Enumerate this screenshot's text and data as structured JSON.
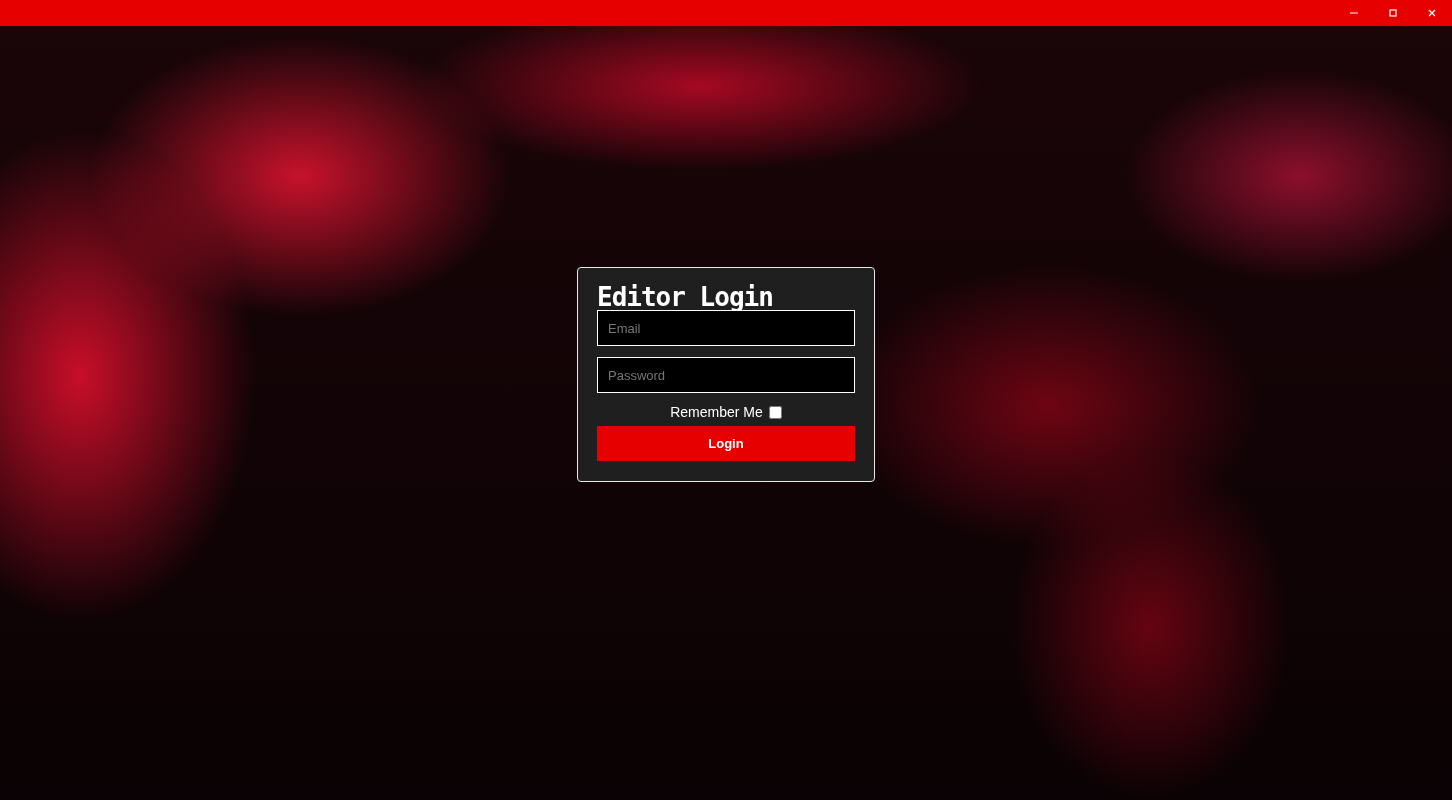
{
  "login_card": {
    "title": "Editor Login",
    "email_field": {
      "placeholder": "Email"
    },
    "password_field": {
      "placeholder": "Password"
    },
    "remember_me": {
      "label": "Remember Me",
      "checked": false
    },
    "login_button": {
      "label": "Login"
    }
  }
}
